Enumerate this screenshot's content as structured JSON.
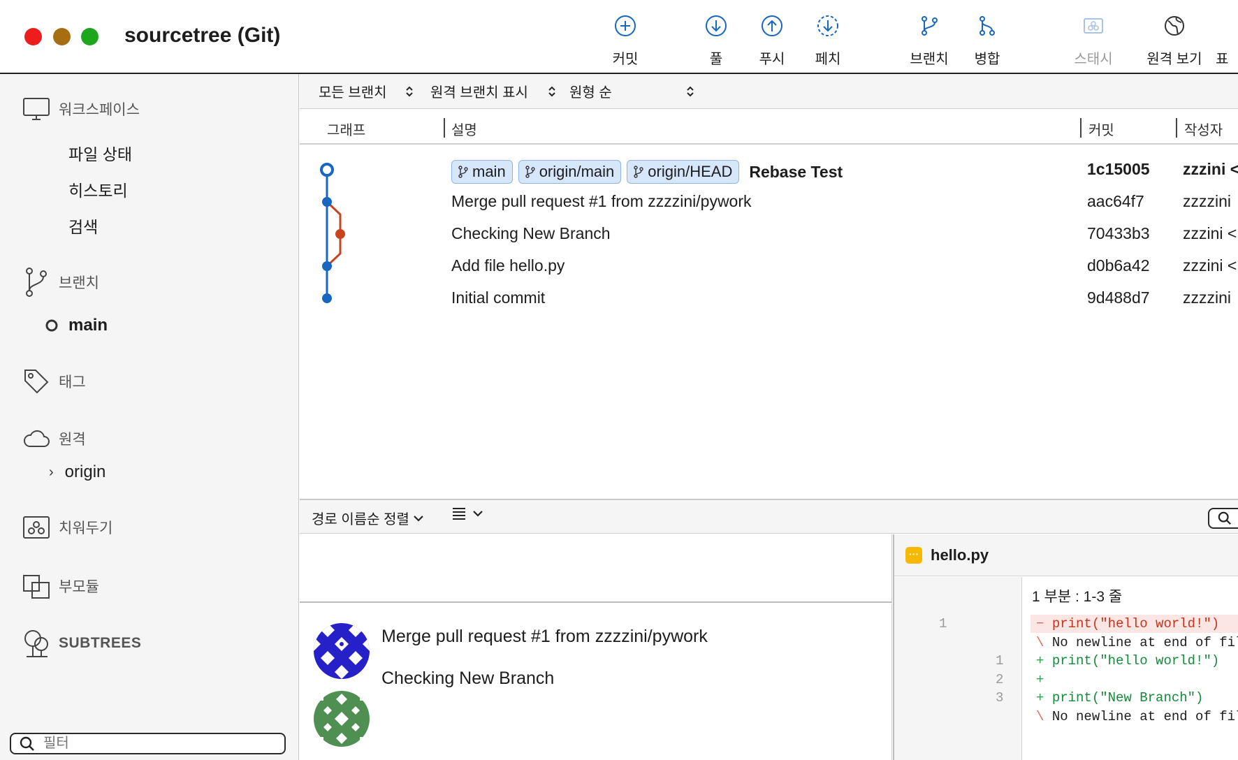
{
  "window": {
    "title": "sourcetree (Git)"
  },
  "toolbar": {
    "commit": "커밋",
    "pull": "풀",
    "push": "푸시",
    "fetch": "페치",
    "branch": "브랜치",
    "merge": "병합",
    "stash": "스태시",
    "show_remote": "원격 보기",
    "overflow": "표"
  },
  "sidebar": {
    "workspace": "워크스페이스",
    "file_status": "파일 상태",
    "history": "히스토리",
    "search": "검색",
    "branches": "브랜치",
    "current_branch": "main",
    "tags": "태그",
    "remotes": "원격",
    "remote_origin": "origin",
    "stashes": "치워두기",
    "submodules": "부모듈",
    "subtrees": "SUBTREES",
    "filter_placeholder": "필터"
  },
  "filterbar": {
    "branches": "모든 브랜치",
    "remote_branches": "원격 브랜치 표시",
    "order": "원형 순"
  },
  "columns": {
    "graph": "그래프",
    "description": "설명",
    "commit": "커밋",
    "author": "작성자"
  },
  "commits": [
    {
      "refs": [
        "main",
        "origin/main",
        "origin/HEAD"
      ],
      "message": "Rebase Test",
      "hash": "1c15005",
      "author": "zzzini <"
    },
    {
      "refs": [],
      "message": "Merge pull request #1 from zzzzini/pywork",
      "hash": "aac64f7",
      "author": "zzzzini"
    },
    {
      "refs": [],
      "message": "Checking New Branch",
      "hash": "70433b3",
      "author": "zzzini <"
    },
    {
      "refs": [],
      "message": "Add file hello.py",
      "hash": "d0b6a42",
      "author": "zzzini <"
    },
    {
      "refs": [],
      "message": "Initial commit",
      "hash": "9d488d7",
      "author": "zzzzini"
    }
  ],
  "lower": {
    "sort": "경로 이름순 정렬",
    "commit_lines": [
      "Merge pull request #1 from zzzzini/pywork",
      "Checking New Branch"
    ]
  },
  "diff": {
    "file": "hello.py",
    "hunk": "1 부분 : 1-3 줄",
    "lines": [
      {
        "old": "1",
        "new": "",
        "kind": "del",
        "marker": "−",
        "text": "print(\"hello world!\")"
      },
      {
        "old": "",
        "new": "",
        "kind": "meta",
        "marker": "\\",
        "text": "No newline at end of file"
      },
      {
        "old": "",
        "new": "1",
        "kind": "add",
        "marker": "+",
        "text": "print(\"hello world!\")"
      },
      {
        "old": "",
        "new": "2",
        "kind": "add",
        "marker": "+",
        "text": ""
      },
      {
        "old": "",
        "new": "3",
        "kind": "add",
        "marker": "+",
        "text": "print(\"New Branch\")"
      },
      {
        "old": "",
        "new": "",
        "kind": "meta",
        "marker": "\\",
        "text": "No newline at end of file"
      }
    ]
  },
  "colors": {
    "graph_main": "#1766c2",
    "graph_branch": "#c9441c",
    "tag_bg": "#d6e6fb",
    "close": "#ee1d1d",
    "minimize": "#a76d11",
    "zoom": "#1da51d"
  }
}
